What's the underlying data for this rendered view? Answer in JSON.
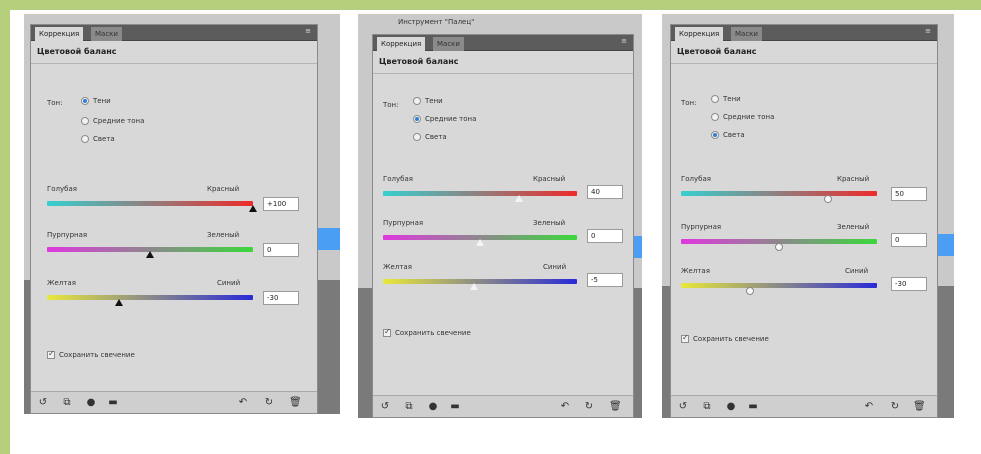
{
  "panels": [
    {
      "tabs": {
        "correction": "Коррекция",
        "masks": "Маски"
      },
      "title": "Цветовой баланс",
      "tone": {
        "label": "Тон:",
        "options": [
          "Тени",
          "Средние тона",
          "Света"
        ],
        "selected": 0
      },
      "sliders": [
        {
          "left": "Голубая",
          "right": "Красный",
          "value": "+100",
          "position": 1.0,
          "gradient": "linear-gradient(90deg,#36d0d0,#ee2a2a)"
        },
        {
          "left": "Пурпурная",
          "right": "Зеленый",
          "value": "0",
          "position": 0.5,
          "gradient": "linear-gradient(90deg,#e038e0,#3ad83a)"
        },
        {
          "left": "Желтая",
          "right": "Синий",
          "value": "-30",
          "position": 0.35,
          "gradient": "linear-gradient(90deg,#e8e83a,#2a2ad8)"
        }
      ],
      "preserve_luminosity": "Сохранить свечение",
      "thumb_style": "triangle-dark"
    },
    {
      "header": "Инструмент \"Палец\"",
      "tabs": {
        "correction": "Коррекция",
        "masks": "Маски"
      },
      "title": "Цветовой баланс",
      "tone": {
        "label": "Тон:",
        "options": [
          "Тени",
          "Средние тона",
          "Света"
        ],
        "selected": 1
      },
      "sliders": [
        {
          "left": "Голубая",
          "right": "Красный",
          "value": "40",
          "position": 0.7,
          "gradient": "linear-gradient(90deg,#36d0d0,#ee2a2a)"
        },
        {
          "left": "Пурпурная",
          "right": "Зеленый",
          "value": "0",
          "position": 0.5,
          "gradient": "linear-gradient(90deg,#e038e0,#3ad83a)"
        },
        {
          "left": "Желтая",
          "right": "Синий",
          "value": "-5",
          "position": 0.47,
          "gradient": "linear-gradient(90deg,#e8e83a,#2a2ad8)"
        }
      ],
      "preserve_luminosity": "Сохранить свечение",
      "thumb_style": "triangle-light"
    },
    {
      "tabs": {
        "correction": "Коррекция",
        "masks": "Маски"
      },
      "title": "Цветовой баланс",
      "tone": {
        "label": "Тон:",
        "options": [
          "Тени",
          "Средние тона",
          "Света"
        ],
        "selected": 2
      },
      "sliders": [
        {
          "left": "Голубая",
          "right": "Красный",
          "value": "50",
          "position": 0.75,
          "gradient": "linear-gradient(90deg,#36d0d0,#ee2a2a)"
        },
        {
          "left": "Пурпурная",
          "right": "Зеленый",
          "value": "0",
          "position": 0.5,
          "gradient": "linear-gradient(90deg,#e038e0,#3ad83a)"
        },
        {
          "left": "Желтая",
          "right": "Синий",
          "value": "-30",
          "position": 0.35,
          "gradient": "linear-gradient(90deg,#e8e83a,#2a2ad8)"
        }
      ],
      "preserve_luminosity": "Сохранить свечение",
      "thumb_style": "circle"
    }
  ],
  "bottom_icons": [
    "return-icon",
    "clip-icon",
    "eye-icon",
    "visibility-icon",
    "reset-icon",
    "refresh-icon",
    "trash-icon"
  ]
}
